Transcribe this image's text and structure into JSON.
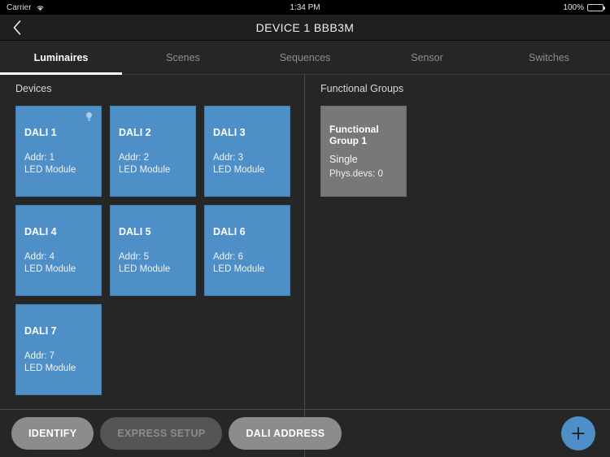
{
  "status_bar": {
    "carrier": "Carrier",
    "wifi_icon": "wifi-icon",
    "time": "1:34 PM",
    "battery_percent": "100%",
    "battery_icon": "battery-full-icon"
  },
  "nav": {
    "back_icon": "chevron-left-icon",
    "title": "DEVICE 1 BBB3M"
  },
  "tabs": [
    {
      "label": "Luminaires",
      "active": true
    },
    {
      "label": "Scenes",
      "active": false
    },
    {
      "label": "Sequences",
      "active": false
    },
    {
      "label": "Sensor",
      "active": false
    },
    {
      "label": "Switches",
      "active": false
    }
  ],
  "devices_panel": {
    "title": "Devices",
    "cards": [
      {
        "title": "DALI 1",
        "addr": "Addr: 1",
        "type": "LED Module",
        "bulb_icon": "light-bulb-icon",
        "has_bulb": true
      },
      {
        "title": "DALI 2",
        "addr": "Addr: 2",
        "type": "LED Module",
        "has_bulb": false
      },
      {
        "title": "DALI 3",
        "addr": "Addr: 3",
        "type": "LED Module",
        "has_bulb": false
      },
      {
        "title": "DALI 4",
        "addr": "Addr: 4",
        "type": "LED Module",
        "has_bulb": false
      },
      {
        "title": "DALI 5",
        "addr": "Addr: 5",
        "type": "LED Module",
        "has_bulb": false
      },
      {
        "title": "DALI 6",
        "addr": "Addr: 6",
        "type": "LED Module",
        "has_bulb": false
      },
      {
        "title": "DALI 7",
        "addr": "Addr: 7",
        "type": "LED Module",
        "has_bulb": false
      }
    ]
  },
  "groups_panel": {
    "title": "Functional Groups",
    "cards": [
      {
        "title": "Functional Group 1",
        "mode": "Single",
        "phys": "Phys.devs: 0"
      }
    ]
  },
  "bottom_bar": {
    "buttons": [
      {
        "label": "IDENTIFY",
        "disabled": false
      },
      {
        "label": "EXPRESS SETUP",
        "disabled": true
      },
      {
        "label": "DALI ADDRESS",
        "disabled": false
      }
    ],
    "fab_icon": "plus-icon"
  },
  "colors": {
    "background": "#262626",
    "card_blue": "#4d8fc6",
    "card_gray": "#787878",
    "accent": "#4d8fc6",
    "navbar": "#1f1f1f"
  }
}
